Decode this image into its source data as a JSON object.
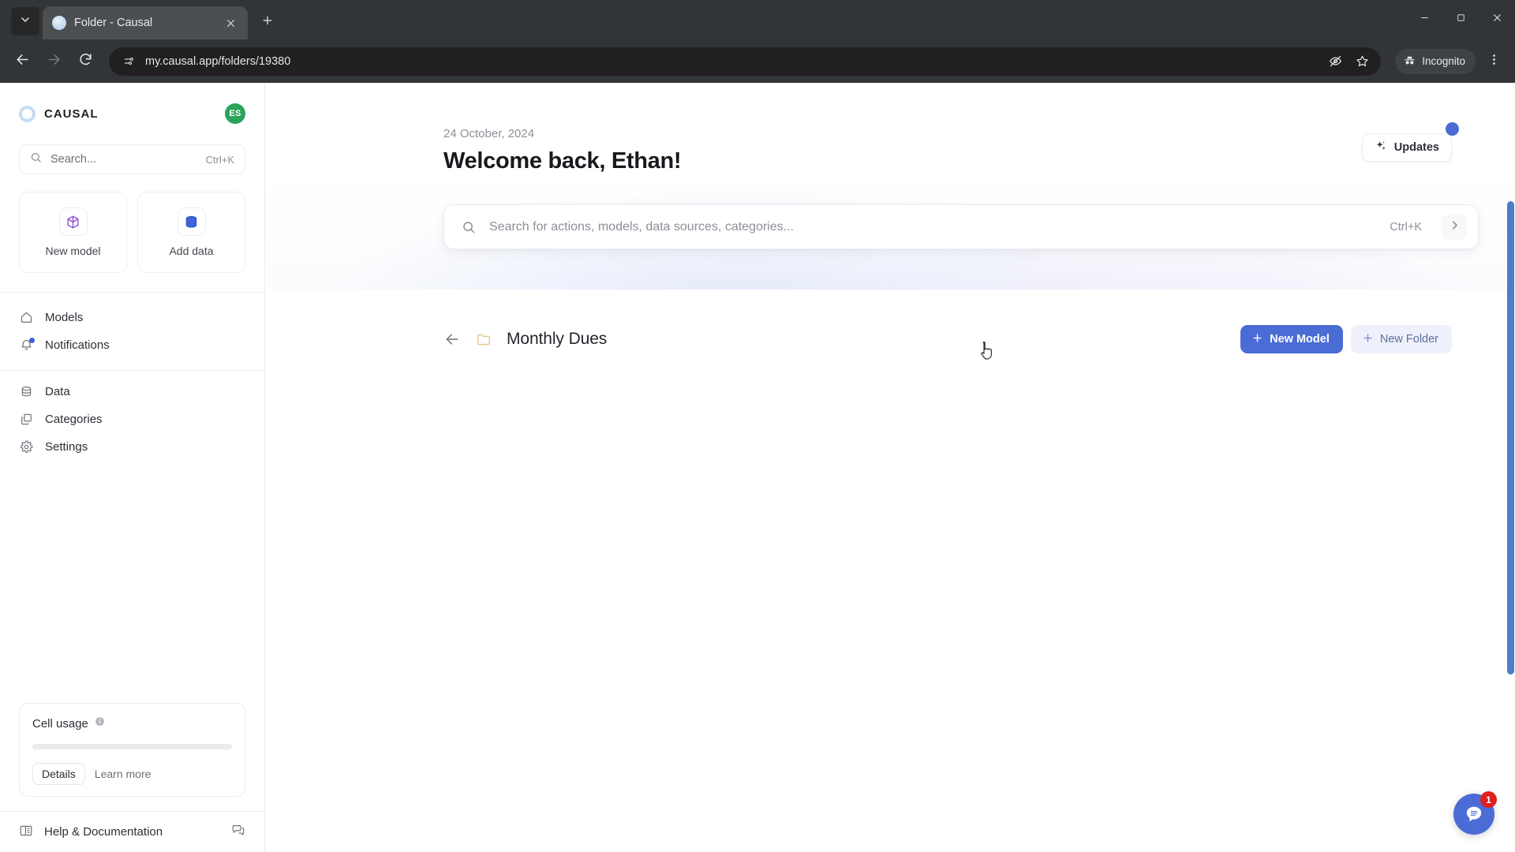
{
  "browser": {
    "tab": {
      "title": "Folder - Causal",
      "favicon_icon": "causal-favicon",
      "close_icon": "close-icon"
    },
    "tab_list_icon": "chevron-down-icon",
    "new_tab_icon": "plus-icon",
    "window": {
      "minimize_icon": "minimize-icon",
      "maximize_icon": "maximize-icon",
      "close_icon": "window-close-icon"
    },
    "nav": {
      "back_icon": "arrow-left-icon",
      "forward_icon": "arrow-right-icon",
      "reload_icon": "reload-icon"
    },
    "omnibox": {
      "site_info_icon": "site-settings-icon",
      "url": "my.causal.app/folders/19380",
      "tracking_icon": "eye-off-icon",
      "bookmark_icon": "star-icon"
    },
    "incognito": {
      "label": "Incognito",
      "icon": "incognito-icon"
    },
    "menu_icon": "kebab-menu-icon"
  },
  "sidebar": {
    "brand": {
      "name": "CAUSAL",
      "logo_icon": "causal-ring-logo"
    },
    "avatar": {
      "initials": "ES",
      "color": "#2aa45a"
    },
    "search": {
      "placeholder": "Search...",
      "shortcut": "Ctrl+K",
      "icon": "search-icon"
    },
    "quick_actions": [
      {
        "label": "New model",
        "icon": "cube-icon"
      },
      {
        "label": "Add data",
        "icon": "database-icon"
      }
    ],
    "nav_primary": [
      {
        "label": "Models",
        "icon": "home-icon",
        "badge": false
      },
      {
        "label": "Notifications",
        "icon": "bell-icon",
        "badge": true
      }
    ],
    "nav_secondary": [
      {
        "label": "Data",
        "icon": "database-icon"
      },
      {
        "label": "Categories",
        "icon": "copy-icon"
      },
      {
        "label": "Settings",
        "icon": "gear-icon"
      }
    ],
    "usage": {
      "title": "Cell usage",
      "info_icon": "info-icon",
      "progress_percent": 0,
      "details_label": "Details",
      "learn_more_label": "Learn more"
    },
    "footer": {
      "help_label": "Help & Documentation",
      "help_icon": "book-icon",
      "feedback_icon": "chat-bubbles-icon"
    }
  },
  "main": {
    "date": "24 October, 2024",
    "greeting": "Welcome back, Ethan!",
    "updates": {
      "label": "Updates",
      "icon": "sparkle-icon",
      "has_notification": true
    },
    "search": {
      "placeholder": "Search for actions, models, data sources, categories...",
      "shortcut": "Ctrl+K",
      "icon": "search-icon",
      "submit_icon": "chevron-right-icon"
    },
    "folder": {
      "name": "Monthly Dues",
      "back_icon": "arrow-left-icon",
      "folder_icon": "folder-icon",
      "actions": [
        {
          "label": "New Model",
          "icon": "plus-icon",
          "style": "primary"
        },
        {
          "label": "New Folder",
          "icon": "plus-icon",
          "style": "secondary"
        }
      ]
    },
    "chat": {
      "badge_count": "1",
      "icon": "chat-bubble-icon",
      "color": "#4a6cd4"
    }
  },
  "colors": {
    "accent_blue": "#4a6cd4",
    "secondary_blue_bg": "#eef1fb",
    "avatar_green": "#2aa45a",
    "badge_red": "#e02020",
    "folder_tan": "#e7cf9a"
  }
}
